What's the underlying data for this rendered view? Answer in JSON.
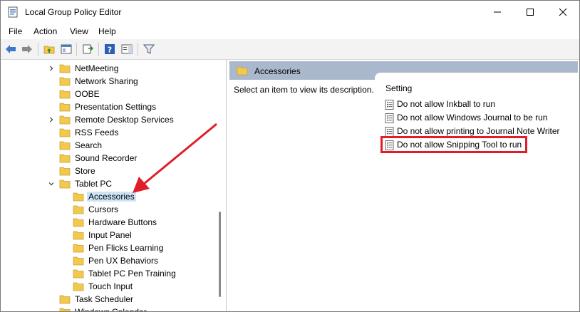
{
  "window": {
    "title": "Local Group Policy Editor"
  },
  "menu": {
    "items": [
      "File",
      "Action",
      "View",
      "Help"
    ]
  },
  "tree": {
    "items": [
      {
        "label": "NetMeeting",
        "expandable": true,
        "level": 1
      },
      {
        "label": "Network Sharing",
        "expandable": false,
        "level": 1
      },
      {
        "label": "OOBE",
        "expandable": false,
        "level": 1
      },
      {
        "label": "Presentation Settings",
        "expandable": false,
        "level": 1
      },
      {
        "label": "Remote Desktop Services",
        "expandable": true,
        "level": 1
      },
      {
        "label": "RSS Feeds",
        "expandable": false,
        "level": 1
      },
      {
        "label": "Search",
        "expandable": false,
        "level": 1
      },
      {
        "label": "Sound Recorder",
        "expandable": false,
        "level": 1
      },
      {
        "label": "Store",
        "expandable": false,
        "level": 1
      },
      {
        "label": "Tablet PC",
        "expandable": true,
        "expanded": true,
        "level": 1
      },
      {
        "label": "Accessories",
        "expandable": false,
        "level": 2,
        "selected": true
      },
      {
        "label": "Cursors",
        "expandable": false,
        "level": 2
      },
      {
        "label": "Hardware Buttons",
        "expandable": false,
        "level": 2
      },
      {
        "label": "Input Panel",
        "expandable": false,
        "level": 2
      },
      {
        "label": "Pen Flicks Learning",
        "expandable": false,
        "level": 2
      },
      {
        "label": "Pen UX Behaviors",
        "expandable": false,
        "level": 2
      },
      {
        "label": "Tablet PC Pen Training",
        "expandable": false,
        "level": 2
      },
      {
        "label": "Touch Input",
        "expandable": false,
        "level": 2
      },
      {
        "label": "Task Scheduler",
        "expandable": false,
        "level": 1
      },
      {
        "label": "Windows Calendar",
        "expandable": false,
        "level": 1
      }
    ]
  },
  "details": {
    "header": "Accessories",
    "description": "Select an item to view its description.",
    "column_header": "Setting",
    "settings": [
      "Do not allow Inkball to run",
      "Do not allow Windows Journal to be run",
      "Do not allow printing to Journal Note Writer",
      "Do not allow Snipping Tool to run"
    ]
  },
  "colors": {
    "accent_highlight": "#e01e2a",
    "selection": "#cce4f7",
    "pane_header": "#a9b8cc",
    "folder": "#f2c94c"
  }
}
